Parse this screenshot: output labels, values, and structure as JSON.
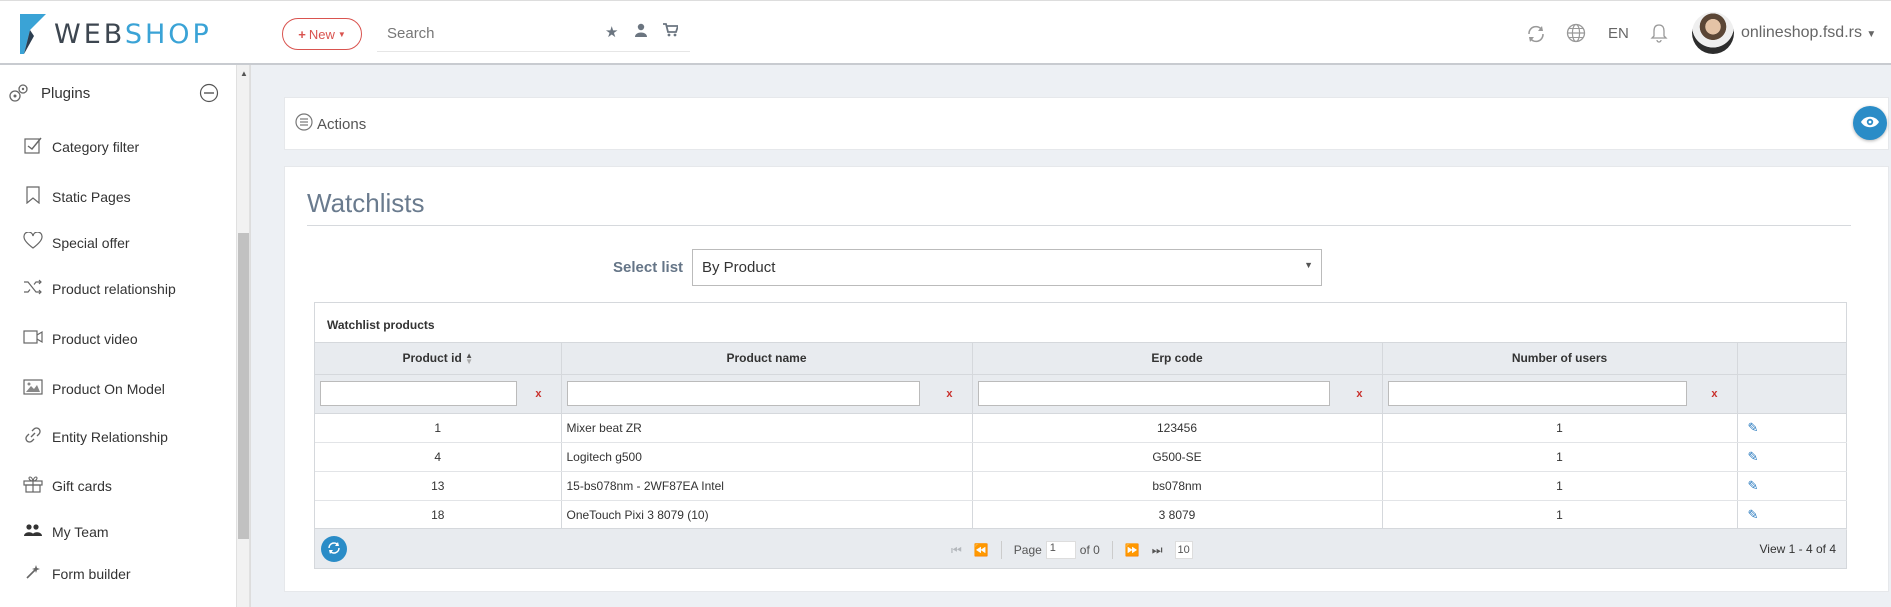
{
  "header": {
    "logo_web": "WEB",
    "logo_shop": "SHOP",
    "new_label": "New",
    "search_placeholder": "Search",
    "lang": "EN",
    "user": "onlineshop.fsd.rs"
  },
  "sidebar": {
    "section": "Plugins",
    "items": [
      {
        "label": "Category filter",
        "icon": "checkbox-icon"
      },
      {
        "label": "Static Pages",
        "icon": "bookmark-icon"
      },
      {
        "label": "Special offer",
        "icon": "heart-icon"
      },
      {
        "label": "Product relationship",
        "icon": "shuffle-icon"
      },
      {
        "label": "Product video",
        "icon": "video-icon"
      },
      {
        "label": "Product On Model",
        "icon": "image-icon"
      },
      {
        "label": "Entity Relationship",
        "icon": "link-icon"
      },
      {
        "label": "Gift cards",
        "icon": "gift-icon"
      },
      {
        "label": "My Team",
        "icon": "users-icon"
      },
      {
        "label": "Form builder",
        "icon": "wand-icon"
      }
    ]
  },
  "actions": {
    "label": "Actions"
  },
  "page": {
    "title": "Watchlists",
    "select_label": "Select list",
    "select_value": "By Product"
  },
  "grid": {
    "caption": "Watchlist products",
    "columns": [
      "Product id",
      "Product name",
      "Erp code",
      "Number of users"
    ],
    "rows": [
      {
        "id": "1",
        "name": "Mixer beat ZR",
        "erp": "123456",
        "users": "1"
      },
      {
        "id": "4",
        "name": "Logitech g500",
        "erp": "G500-SE",
        "users": "1"
      },
      {
        "id": "13",
        "name": "15-bs078nm - 2WF87EA Intel",
        "erp": "bs078nm",
        "users": "1"
      },
      {
        "id": "18",
        "name": "OneTouch Pixi 3 8079 (10)",
        "erp": "3 8079",
        "users": "1"
      }
    ],
    "pager": {
      "page_label": "Page",
      "page_value": "1",
      "of_label": "of 0",
      "page_size": "10",
      "view_info": "View 1 - 4 of 4"
    }
  },
  "colors": {
    "accent": "#2a8cc7",
    "brand_blue": "#3aa3d6",
    "danger": "#d9534f"
  }
}
